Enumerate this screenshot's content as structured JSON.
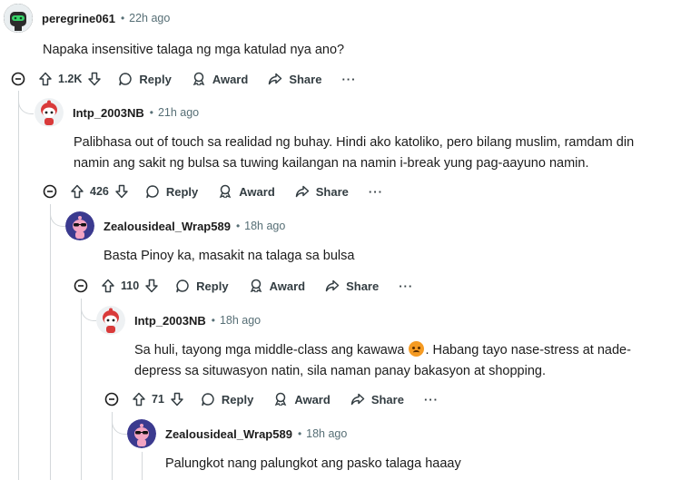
{
  "comments": [
    {
      "username": "peregrine061",
      "time": "22h ago",
      "text": "Napaka insensitive talaga ng mga katulad nya ano?",
      "votes": "1.2K",
      "avatar": "green-visor-robot"
    },
    {
      "username": "Intp_2003NB",
      "time": "21h ago",
      "text": "Palibhasa out of touch sa realidad ng buhay. Hindi ako katoliko, pero bilang muslim, ramdam din namin ang sakit ng bulsa sa tuwing kailangan na namin i-break yung pag-aayuno namin.",
      "votes": "426",
      "avatar": "red-helmet-snoo"
    },
    {
      "username": "Zealousideal_Wrap589",
      "time": "18h ago",
      "text": "Basta Pinoy ka, masakit na talaga sa bulsa",
      "votes": "110",
      "avatar": "pink-sunglasses-snoo"
    },
    {
      "username": "Intp_2003NB",
      "time": "18h ago",
      "text_before": "Sa huli, tayong mga middle-class ang kawawa ",
      "emoji": "sad-face-emoji",
      "text_after": ". Habang tayo nase-stress at nade-depress sa situwasyon natin, sila naman panay bakasyon at shopping.",
      "votes": "71",
      "avatar": "red-helmet-snoo"
    },
    {
      "username": "Zealousideal_Wrap589",
      "time": "18h ago",
      "text": "Palungkot nang palungkot ang pasko talaga haaay",
      "avatar": "pink-sunglasses-snoo"
    }
  ],
  "actions": {
    "reply": "Reply",
    "award": "Award",
    "share": "Share",
    "more": "···",
    "separator": "•"
  },
  "colors": {
    "text": "#1c1c1c",
    "meta": "#576f76",
    "thread_line": "#d4d8db"
  }
}
